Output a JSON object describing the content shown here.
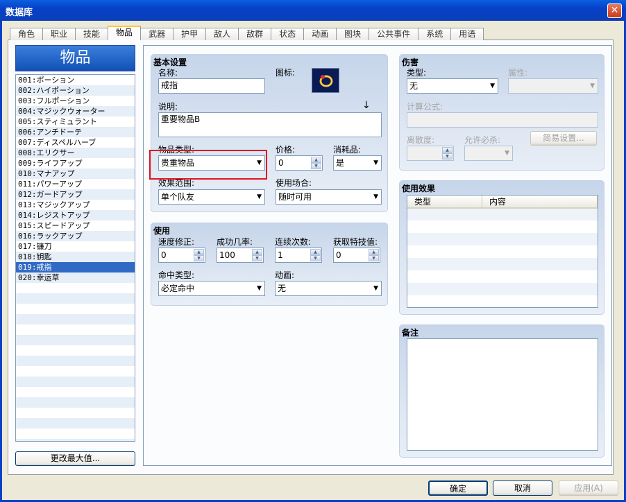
{
  "window": {
    "title": "数据库",
    "close_glyph": "✕"
  },
  "tabs": [
    "角色",
    "职业",
    "技能",
    "物品",
    "武器",
    "护甲",
    "敌人",
    "敌群",
    "状态",
    "动画",
    "图块",
    "公共事件",
    "系统",
    "用语"
  ],
  "list": {
    "header": "物品",
    "items": [
      "001:ポーション",
      "002:ハイポーション",
      "003:フルポーション",
      "004:マジックウォーター",
      "005:スティミュラント",
      "006:アンチドーテ",
      "007:ディスペルハーブ",
      "008:エリクサー",
      "009:ライフアップ",
      "010:マナアップ",
      "011:パワーアップ",
      "012:ガードアップ",
      "013:マジックアップ",
      "014:レジストアップ",
      "015:スピードアップ",
      "016:ラックアップ",
      "017:镰刀",
      "018:钥匙",
      "019:戒指",
      "020:幸运草"
    ],
    "selected_index": 18,
    "change_max_button": "更改最大值..."
  },
  "basic": {
    "title": "基本设置",
    "name_label": "名称:",
    "name_value": "戒指",
    "icon_label": "图标:",
    "desc_label": "说明:",
    "desc_arrow": "↓",
    "desc_value": "重要物品B",
    "item_type_label": "物品类型:",
    "item_type_value": "贵重物品",
    "price_label": "价格:",
    "price_value": "0",
    "consumable_label": "消耗品:",
    "consumable_value": "是",
    "scope_label": "效果范围:",
    "scope_value": "单个队友",
    "occasion_label": "使用场合:",
    "occasion_value": "随时可用"
  },
  "usage": {
    "title": "使用",
    "speed_label": "速度修正:",
    "speed_value": "0",
    "success_label": "成功几率:",
    "success_value": "100",
    "repeats_label": "连续次数:",
    "repeats_value": "1",
    "tp_label": "获取特技值:",
    "tp_value": "0",
    "hit_type_label": "命中类型:",
    "hit_type_value": "必定命中",
    "animation_label": "动画:",
    "animation_value": "无"
  },
  "damage": {
    "title": "伤害",
    "type_label": "类型:",
    "type_value": "无",
    "element_label": "属性:",
    "formula_label": "计算公式:",
    "variance_label": "离散度:",
    "critical_label": "允许必杀:",
    "simple_button": "简易设置..."
  },
  "effects": {
    "title": "使用效果",
    "col_type": "类型",
    "col_content": "内容"
  },
  "notes": {
    "title": "备注"
  },
  "footer": {
    "ok": "确定",
    "cancel": "取消",
    "apply": "应用(A)"
  },
  "colors": {
    "selection": "#316AC5",
    "highlight_box": "#E0141E",
    "titlebar": "#0841C8"
  }
}
